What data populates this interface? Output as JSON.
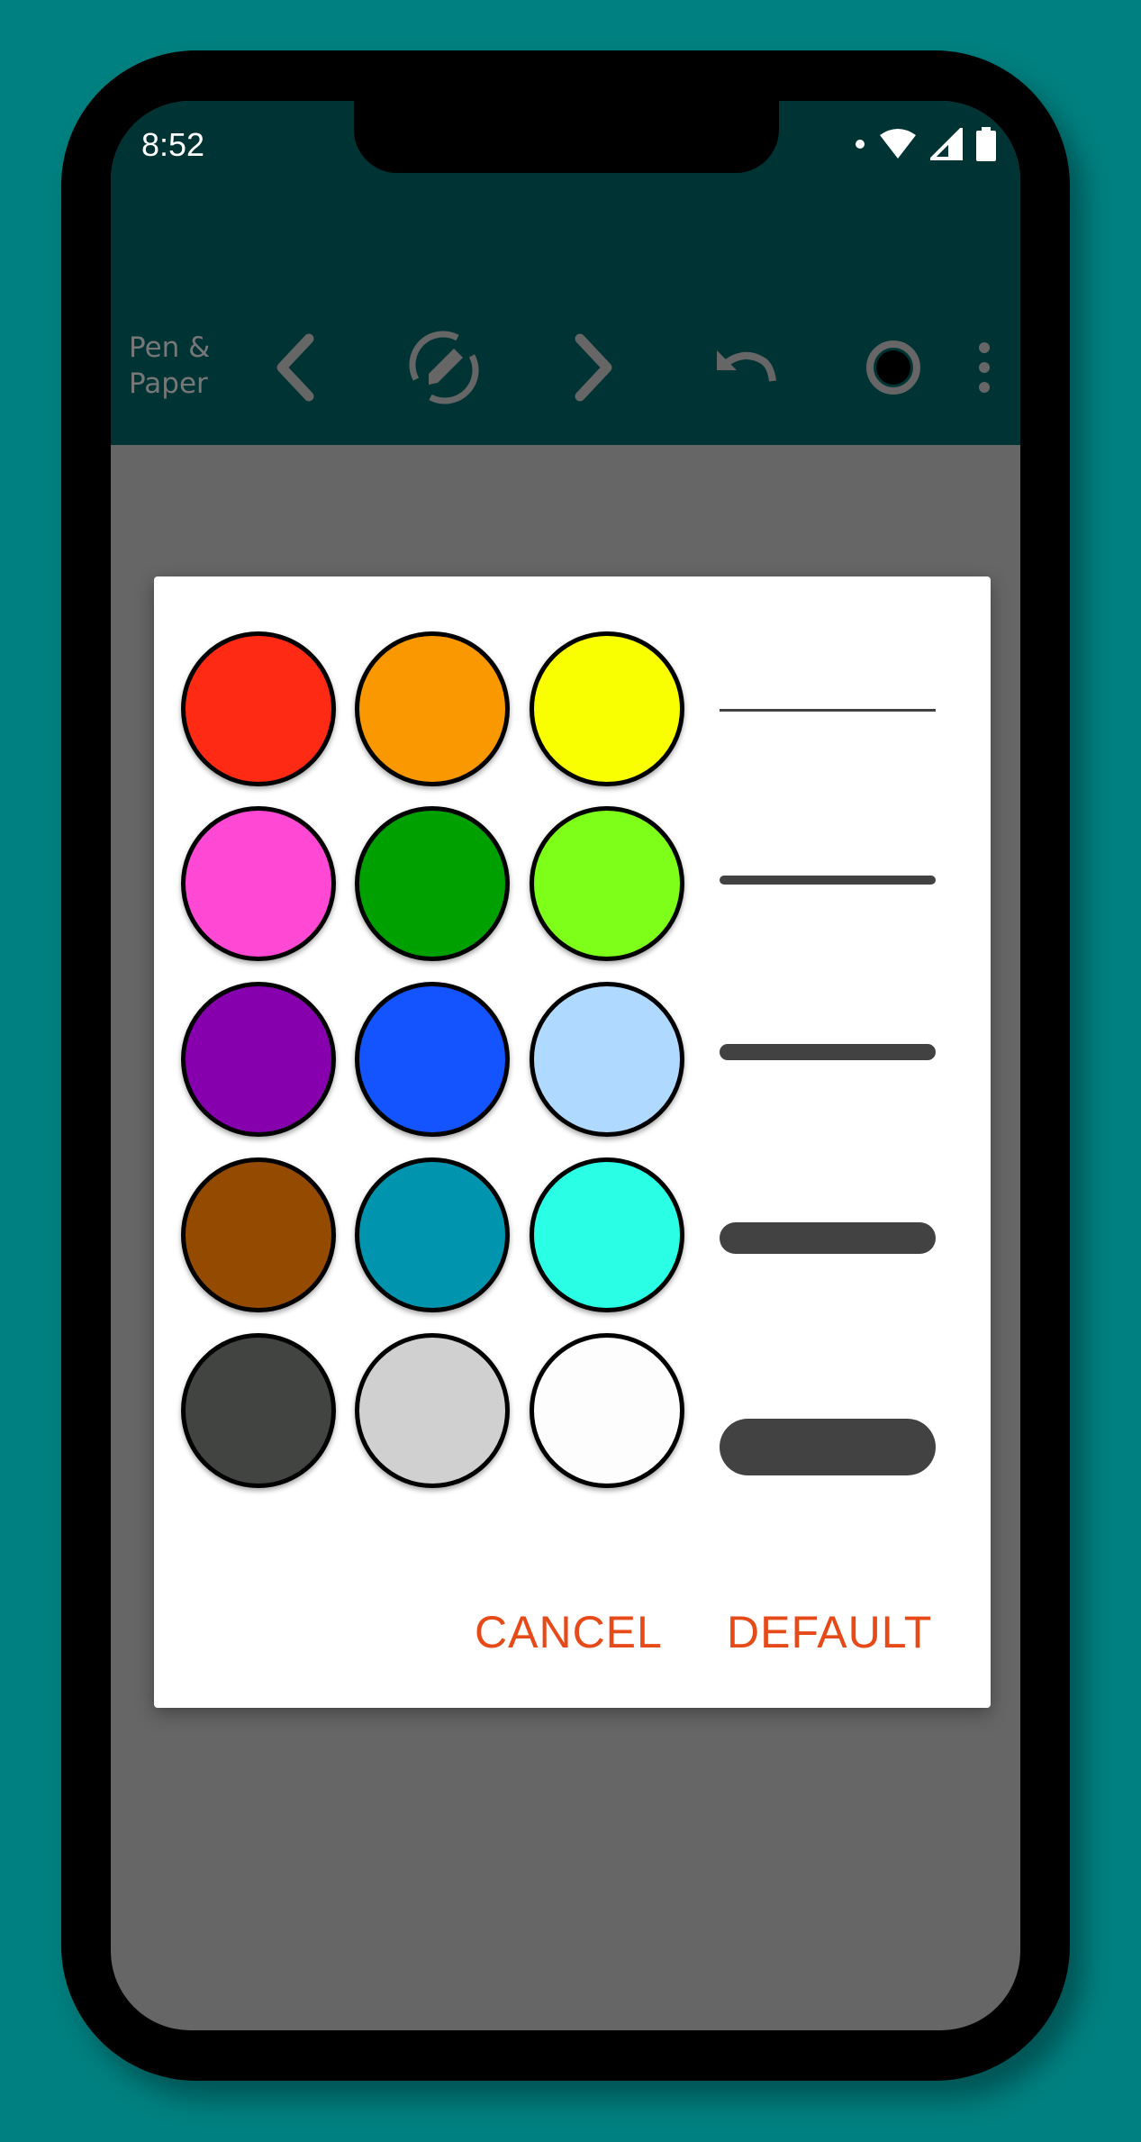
{
  "status": {
    "time": "8:52"
  },
  "toolbar": {
    "title_line1": "Pen &",
    "title_line2": "Paper",
    "icons": [
      "chevron-left-icon",
      "edit-off-icon",
      "chevron-right-icon",
      "undo-icon",
      "brush-size-icon",
      "more-vert-icon"
    ]
  },
  "dialog": {
    "colors": [
      [
        "#ff2a13",
        "#f99800",
        "#f9ff00"
      ],
      [
        "#ff48d4",
        "#00a000",
        "#7eff1a"
      ],
      [
        "#8600ad",
        "#1354ff",
        "#b0d9ff"
      ],
      [
        "#944b00",
        "#0094ae",
        "#2affe5"
      ],
      [
        "#424442",
        "#d0d0d0",
        "#fdfdfd"
      ]
    ],
    "line_widths": [
      "very-thin",
      "thin",
      "medium",
      "thick",
      "very-thick"
    ],
    "cancel_label": "CANCEL",
    "default_label": "DEFAULT"
  },
  "theme": {
    "background": "#008080",
    "appbar": "#003333",
    "scrim": "#666666",
    "accent": "#e64a19"
  }
}
